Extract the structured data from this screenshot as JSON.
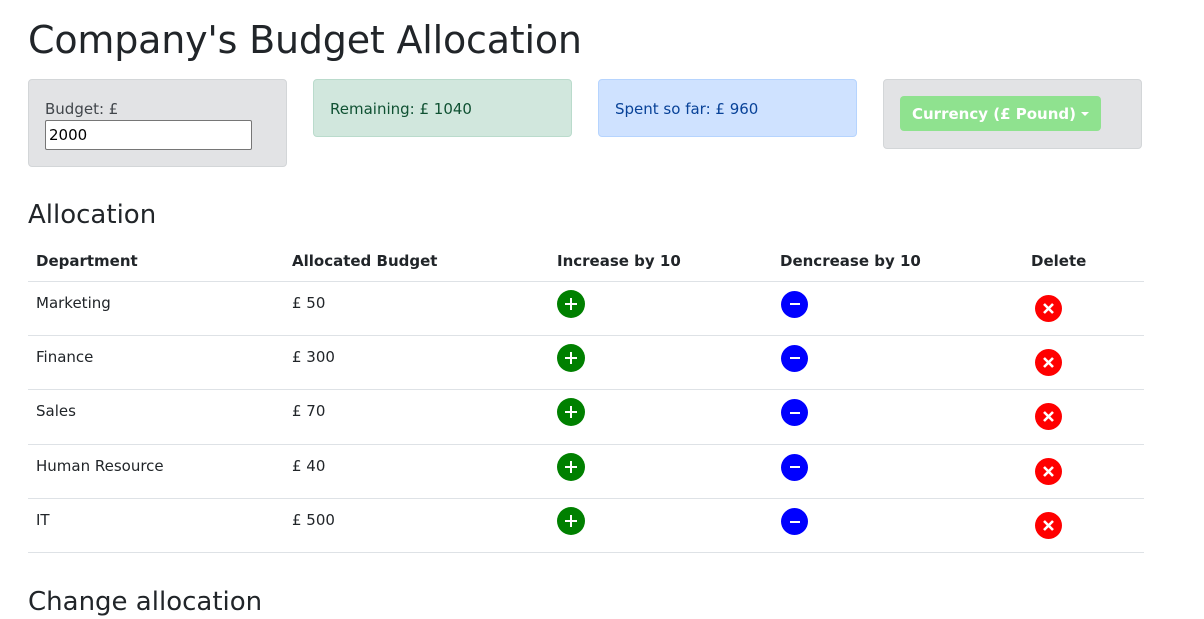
{
  "header": {
    "title": "Company's Budget Allocation"
  },
  "budget_card": {
    "label": "Budget: £",
    "value": "2000"
  },
  "remaining_card": {
    "text": "Remaining: £ 1040"
  },
  "spent_card": {
    "text": "Spent so far: £ 960"
  },
  "currency": {
    "label": "Currency (£ Pound)",
    "button_color": "#8fe28f"
  },
  "allocation": {
    "title": "Allocation",
    "columns": [
      "Department",
      "Allocated Budget",
      "Increase by 10",
      "Dencrease by 10",
      "Delete"
    ],
    "rows": [
      {
        "department": "Marketing",
        "budget": "£ 50"
      },
      {
        "department": "Finance",
        "budget": "£ 300"
      },
      {
        "department": "Sales",
        "budget": "£ 70"
      },
      {
        "department": "Human Resource",
        "budget": "£ 40"
      },
      {
        "department": "IT",
        "budget": "£ 500"
      }
    ],
    "icons": {
      "increase": "plus-circle-icon",
      "decrease": "minus-circle-icon",
      "delete": "x-circle-icon"
    },
    "colors": {
      "increase": "#008000",
      "decrease": "#0000ff",
      "delete": "#ff0000"
    }
  },
  "change_section": {
    "title": "Change allocation"
  }
}
